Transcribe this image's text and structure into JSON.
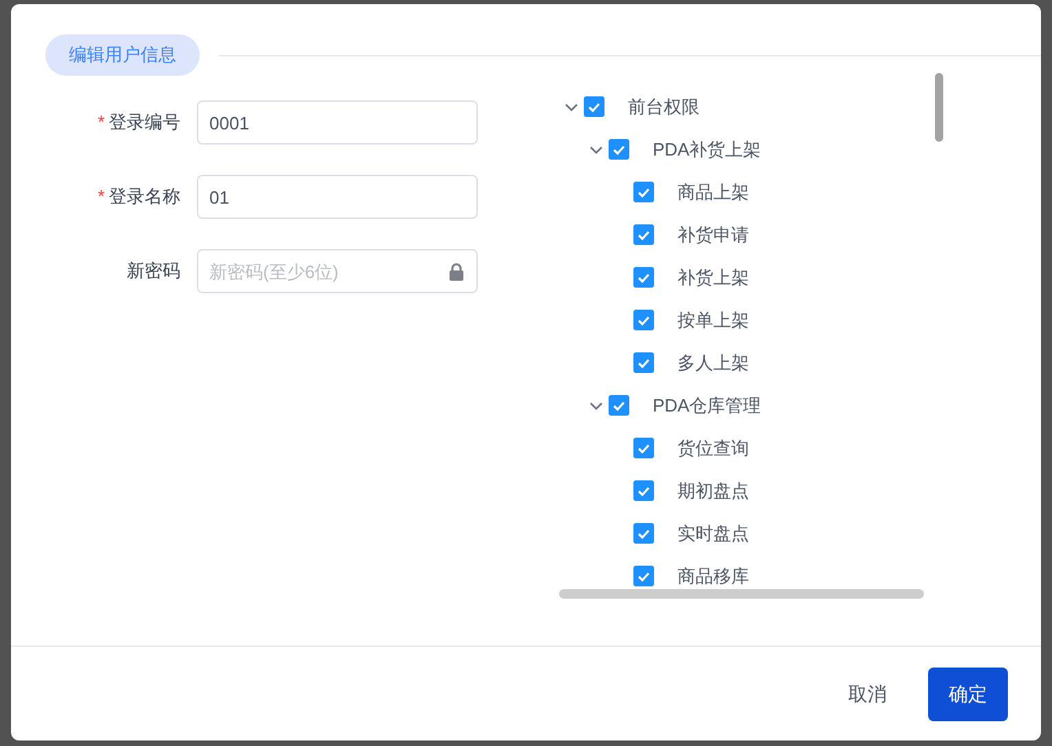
{
  "section_title": "编辑用户信息",
  "fields": [
    {
      "label": "登录编号",
      "required_mark": "*",
      "value": "0001"
    },
    {
      "label": "登录名称",
      "required_mark": "*",
      "value": "01"
    },
    {
      "label": "新密码",
      "placeholder": "新密码(至少6位)",
      "kind": "password"
    }
  ],
  "tree": [
    {
      "label": "前台权限",
      "checked": true,
      "expanded": true,
      "children": [
        {
          "label": "PDA补货上架",
          "checked": true,
          "expanded": true,
          "children": [
            {
              "label": "商品上架",
              "checked": true
            },
            {
              "label": "补货申请",
              "checked": true
            },
            {
              "label": "补货上架",
              "checked": true
            },
            {
              "label": "按单上架",
              "checked": true
            },
            {
              "label": "多人上架",
              "checked": true
            }
          ]
        },
        {
          "label": "PDA仓库管理",
          "checked": true,
          "expanded": true,
          "children": [
            {
              "label": "货位查询",
              "checked": true
            },
            {
              "label": "期初盘点",
              "checked": true
            },
            {
              "label": "实时盘点",
              "checked": true
            },
            {
              "label": "商品移库",
              "checked": true
            }
          ]
        }
      ]
    }
  ],
  "buttons": [
    {
      "label": "取消",
      "kind": "secondary"
    },
    {
      "label": "确定",
      "kind": "primary"
    }
  ]
}
